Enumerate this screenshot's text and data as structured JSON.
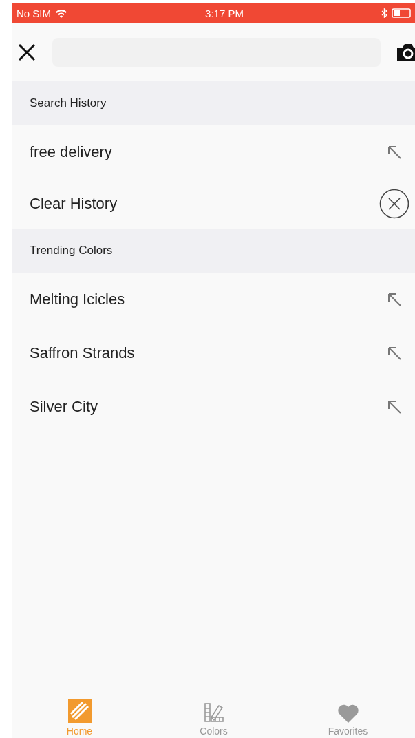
{
  "status_bar": {
    "carrier": "No SIM",
    "time": "3:17 PM"
  },
  "sections": [
    {
      "title": "Search History",
      "items": [
        {
          "label": "free delivery",
          "kind": "suggestion"
        },
        {
          "label": "Clear History",
          "kind": "clear"
        }
      ]
    },
    {
      "title": "Trending Colors",
      "items": [
        {
          "label": "Melting Icicles",
          "kind": "suggestion"
        },
        {
          "label": "Saffron Strands",
          "kind": "suggestion"
        },
        {
          "label": "Silver City",
          "kind": "suggestion"
        }
      ]
    }
  ],
  "tabs": [
    {
      "label": "Home",
      "kind": "home",
      "selected": true
    },
    {
      "label": "Colors",
      "kind": "colors",
      "selected": false
    },
    {
      "label": "Favorites",
      "kind": "favorites",
      "selected": false
    }
  ]
}
